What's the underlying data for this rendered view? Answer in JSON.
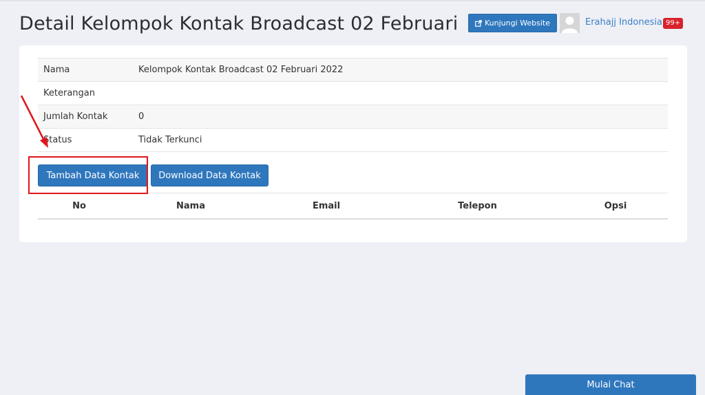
{
  "header": {
    "title": "Detail Kelompok Kontak Broadcast 02 Februari",
    "visit_website_label": "Kunjungi Website",
    "user_name": "Erahajj Indonesia",
    "notification_badge": "99+",
    "trailing_dot": "."
  },
  "details": [
    {
      "key": "Nama",
      "value": "Kelompok Kontak Broadcast 02 Februari 2022"
    },
    {
      "key": "Keterangan",
      "value": ""
    },
    {
      "key": "Jumlah Kontak",
      "value": "0"
    },
    {
      "key": "Status",
      "value": "Tidak Terkunci"
    }
  ],
  "actions": {
    "add_label": "Tambah Data Kontak",
    "download_label": "Download Data Kontak"
  },
  "contacts_table": {
    "columns": [
      "No",
      "Nama",
      "Email",
      "Telepon",
      "Opsi"
    ]
  },
  "chat": {
    "label": "Mulai Chat"
  },
  "colors": {
    "primary": "#2f77bd",
    "annotation_red": "#e2141b",
    "badge_red": "#d9222a",
    "background": "#eef0f6"
  },
  "icons": [
    "external-link-icon",
    "user-avatar-icon"
  ]
}
